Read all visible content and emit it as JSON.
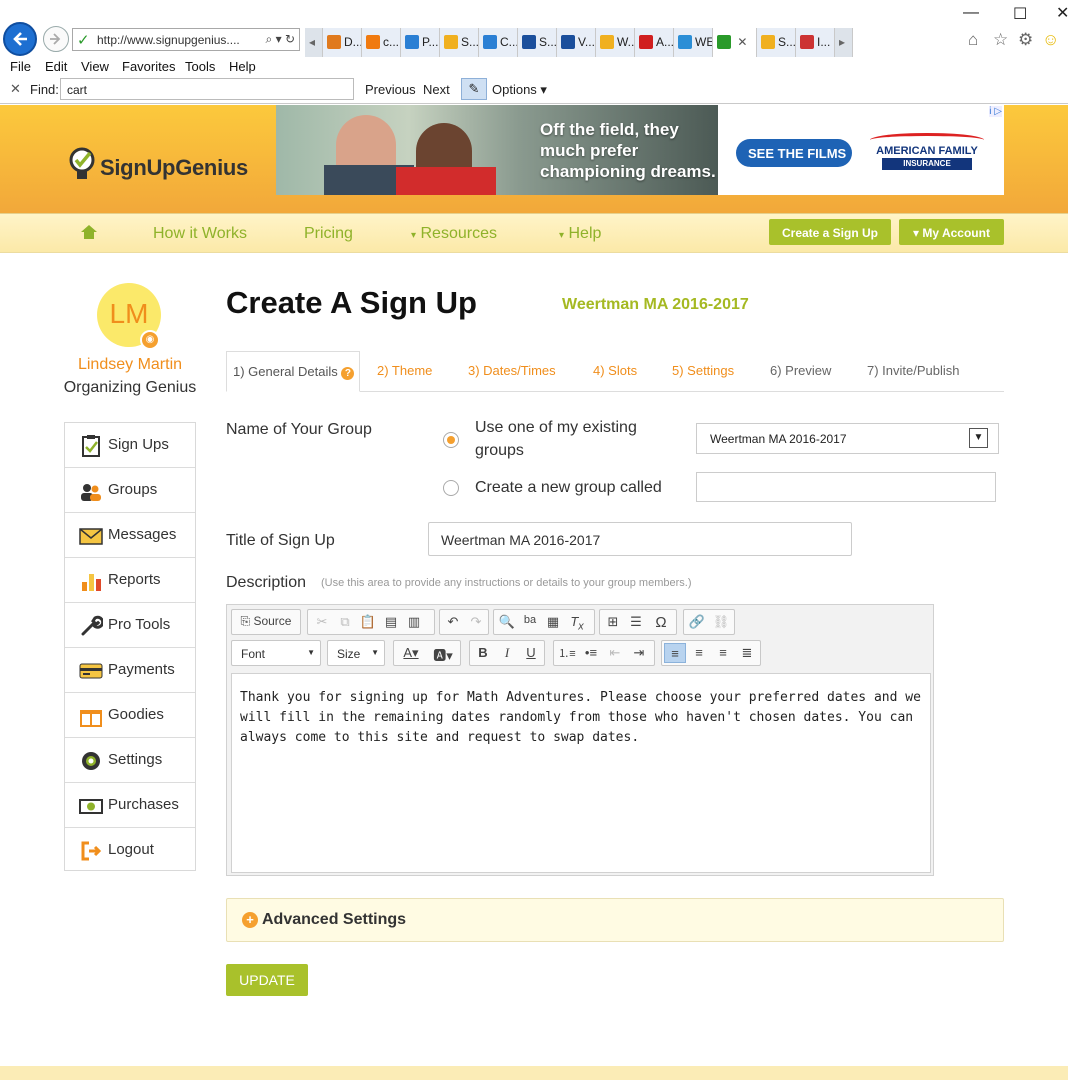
{
  "browser": {
    "address": "http://www.signupgenius....",
    "tabs": [
      {
        "label": "D...",
        "color": "#e07a1e"
      },
      {
        "label": "c...",
        "color": "#f07a10"
      },
      {
        "label": "P...",
        "color": "#2a7fd4"
      },
      {
        "label": "S...",
        "color": "#f0b020"
      },
      {
        "label": "C...",
        "color": "#2a7fd4"
      },
      {
        "label": "S...",
        "color": "#1b4f9c"
      },
      {
        "label": "V...",
        "color": "#1b4f9c"
      },
      {
        "label": "W...",
        "color": "#f0b020"
      },
      {
        "label": "A...",
        "color": "#d01f1f"
      },
      {
        "label": "WE",
        "color": "#2b8ed6"
      },
      {
        "label": "",
        "color": "#2a9a2a"
      },
      {
        "label": "S...",
        "color": "#f0b020"
      },
      {
        "label": "I...",
        "color": "#c33"
      }
    ],
    "menu": [
      "File",
      "Edit",
      "View",
      "Favorites",
      "Tools",
      "Help"
    ],
    "find": {
      "label": "Find:",
      "value": "cart",
      "previous": "Previous",
      "next": "Next",
      "options": "Options"
    }
  },
  "header": {
    "logo_text": "SignUpGenius",
    "ad": {
      "headline": "Off the field, they much prefer championing dreams.",
      "cta": "SEE THE FILMS",
      "brand_line1": "AMERICAN FAMILY",
      "brand_line2": "INSURANCE"
    }
  },
  "nav": {
    "items": [
      "How it Works",
      "Pricing",
      "Resources",
      "Help"
    ],
    "create_button": "Create a Sign Up",
    "account_button": "My Account"
  },
  "profile": {
    "initials": "LM",
    "name": "Lindsey Martin",
    "role": "Organizing Genius"
  },
  "sidebar": {
    "items": [
      "Sign Ups",
      "Groups",
      "Messages",
      "Reports",
      "Pro Tools",
      "Payments",
      "Goodies",
      "Settings",
      "Purchases",
      "Logout"
    ]
  },
  "main": {
    "title": "Create A Sign Up",
    "group_name": "Weertman MA 2016-2017",
    "steps": [
      "1) General Details",
      "2) Theme",
      "3) Dates/Times",
      "4) Slots",
      "5) Settings",
      "6) Preview",
      "7) Invite/Publish"
    ],
    "group_label": "Name of Your Group",
    "existing_option_line1": "Use one of my existing",
    "existing_option_line2": "groups",
    "new_option": "Create a new group called",
    "selected_group": "Weertman MA 2016-2017",
    "new_group_value": "",
    "title_label": "Title of Sign Up",
    "title_value": "Weertman MA 2016-2017",
    "description_label": "Description",
    "description_hint": "(Use this area to provide any instructions or details to your group members.)",
    "editor": {
      "source_label": "Source",
      "font_label": "Font",
      "size_label": "Size",
      "content": "Thank you for signing up for Math Adventures. Please choose your preferred dates and we will fill in the remaining dates randomly from those who haven't chosen dates. You can always come to this site and request to swap dates."
    },
    "advanced_label": "Advanced Settings",
    "update_button": "UPDATE"
  }
}
